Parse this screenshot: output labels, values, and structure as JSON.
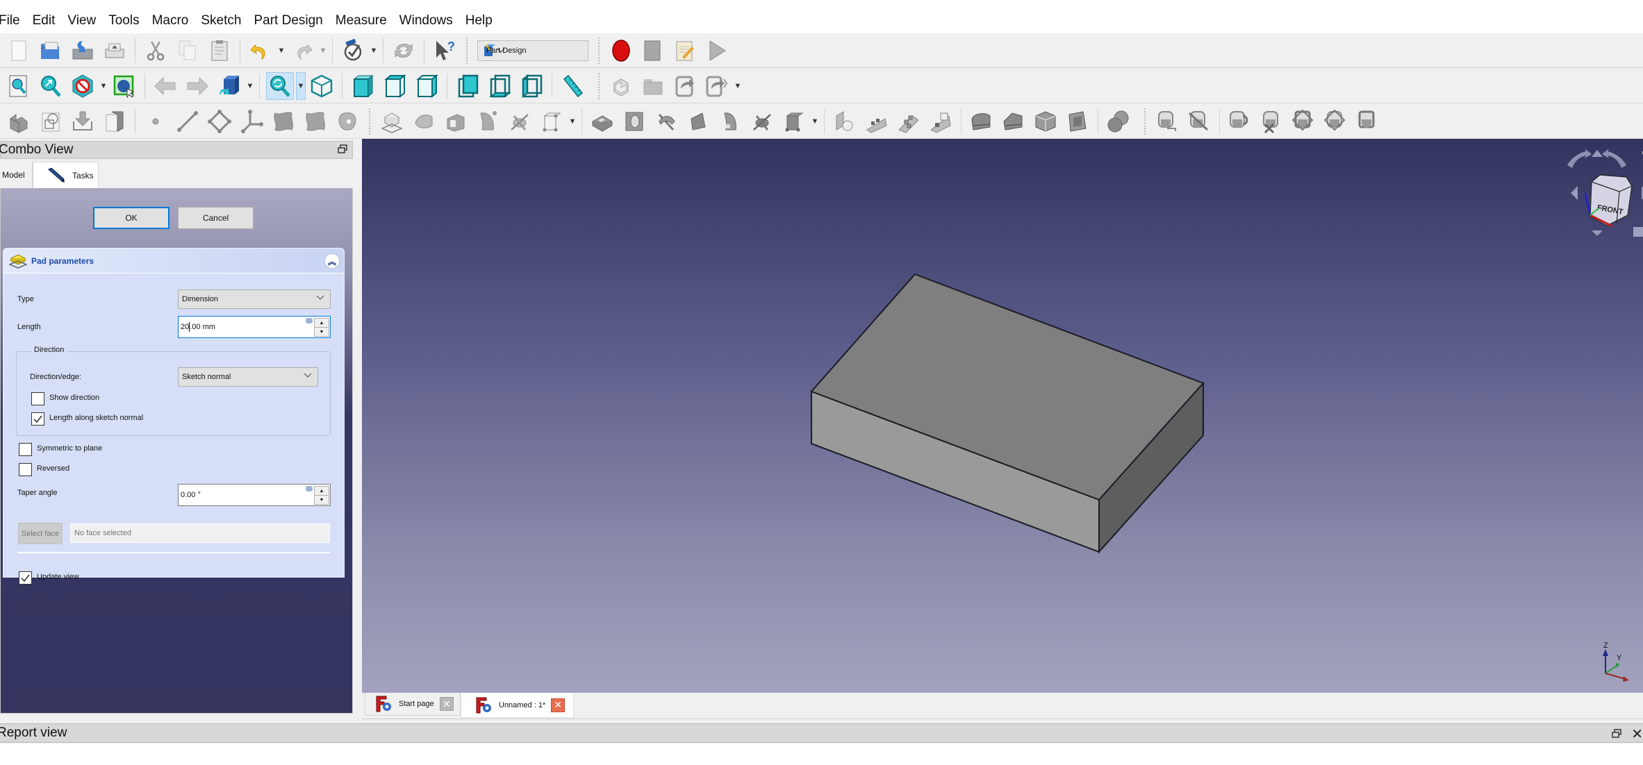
{
  "menubar": {
    "items": [
      "File",
      "Edit",
      "View",
      "Tools",
      "Macro",
      "Sketch",
      "Part Design",
      "Measure",
      "Windows",
      "Help"
    ]
  },
  "toolbar": {
    "workbench": "Part Design",
    "file_tools": [
      "new-document-icon",
      "open-icon",
      "save-icon",
      "export-icon",
      "cut-icon",
      "copy-icon",
      "paste-icon",
      "undo-icon",
      "redo-icon",
      "refresh-recompute-icon",
      "whats-this-icon"
    ],
    "macro_tools": [
      "record-macro-icon",
      "stop-macro-icon",
      "edit-macro-icon",
      "run-macro-icon"
    ],
    "view_tools": [
      "fit-all-icon",
      "fit-selection-icon",
      "draw-style-icon",
      "bounding-box-icon",
      "back-icon",
      "forward-icon",
      "send-to-python-icon",
      "sync-view-icon",
      "isometric-view-icon",
      "front-view-icon",
      "top-view-icon",
      "right-view-icon",
      "rear-view-icon",
      "bottom-view-icon",
      "left-view-icon",
      "measure-distance-icon"
    ],
    "part_tools": [
      "create-body-icon",
      "create-folder-icon",
      "create-link-icon",
      "link-actions-icon"
    ],
    "sketch_tools": [
      "body-icon",
      "shape-binder-icon",
      "import-shape-icon",
      "clone-icon",
      "point-icon",
      "line-icon",
      "plane-icon",
      "local-cs-icon",
      "shape-binder-sub-icon",
      "sub-shape-binder-icon",
      "clone-sheep-icon"
    ],
    "feature_tools": [
      "new-sketch-icon",
      "pad-icon",
      "pocket-icon",
      "revolution-icon",
      "loft-icon",
      "sweep-icon",
      "helix-icon",
      "primitive-icon",
      "hole-icon",
      "groove-icon",
      "subtractive-loft-icon",
      "subtractive-pipe-icon",
      "subtractive-helix-icon",
      "subtractive-primitive-icon",
      "mirrored-icon",
      "linear-pattern-icon",
      "polar-pattern-icon",
      "multi-transform-icon",
      "fillet-icon",
      "chamfer-icon",
      "draft-icon",
      "thickness-icon",
      "boolean-icon"
    ],
    "measure_tools": [
      "measure-linear-icon",
      "measure-angular-icon",
      "measure-refresh-icon",
      "measure-clear-icon",
      "measure-toggle-all-icon",
      "measure-toggle-3d-icon",
      "measure-toggle-delta-icon"
    ]
  },
  "combo_view": {
    "title": "Combo View",
    "tabs": [
      {
        "label": "Model",
        "active": false
      },
      {
        "label": "Tasks",
        "active": true
      }
    ],
    "ok_label": "OK",
    "cancel_label": "Cancel"
  },
  "pad": {
    "title": "Pad parameters",
    "type_label": "Type",
    "type_value": "Dimension",
    "length_label": "Length",
    "length_value_before_cursor": "20",
    "length_value_after_cursor": ".00 mm",
    "direction_group": "Direction",
    "direction_edge_label": "Direction/edge:",
    "direction_edge_value": "Sketch normal",
    "show_direction_label": "Show direction",
    "show_direction_checked": false,
    "along_normal_label": "Length along sketch normal",
    "along_normal_checked": true,
    "symmetric_label": "Symmetric to plane",
    "symmetric_checked": false,
    "reversed_label": "Reversed",
    "reversed_checked": false,
    "taper_label": "Taper angle",
    "taper_value": "0.00 °",
    "select_face_label": "Select face",
    "face_placeholder": "No face selected",
    "update_view_label": "Update view",
    "update_view_checked": true
  },
  "viewport": {
    "navcube_face": "FRONT",
    "axis_labels": [
      "Z",
      "Y"
    ],
    "colors": {
      "bg_top": "#33335f",
      "bg_bottom": "#a3a3bf",
      "top_face": "#7f7f7f",
      "front_face": "#9a9a9a",
      "side_face": "#5e5e5e",
      "edge": "#1a1a24"
    }
  },
  "doc_tabs": [
    {
      "label": "Start page",
      "active": false
    },
    {
      "label": "Unnamed : 1*",
      "active": true
    }
  ],
  "report_view": {
    "title": "Report view"
  }
}
